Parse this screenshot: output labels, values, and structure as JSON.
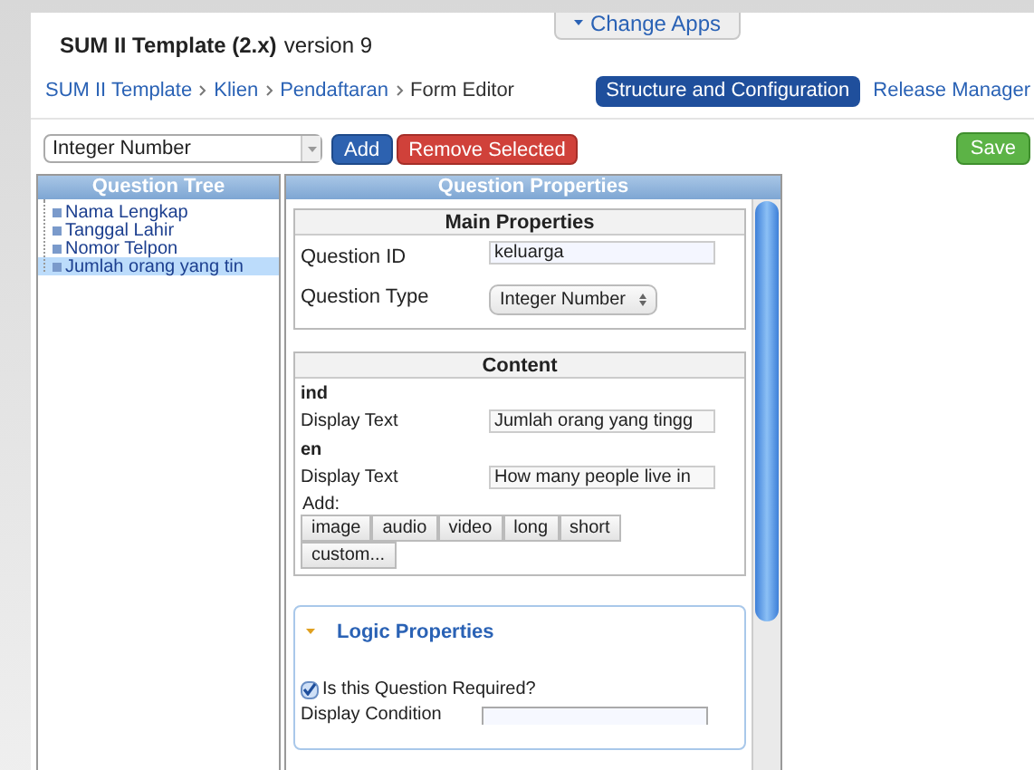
{
  "app_title": {
    "name": "SUM II Template (2.x)",
    "version": "version 9"
  },
  "change_apps": {
    "label": "Change Apps"
  },
  "breadcrumb": [
    "SUM II Template",
    "Klien",
    "Pendaftaran",
    "Form Editor"
  ],
  "nav_tabs": [
    {
      "label": "Structure and Configuration",
      "selected": true
    },
    {
      "label": "Release Manager",
      "selected": false
    }
  ],
  "toolbar": {
    "type_select": "Integer Number",
    "buttons": [
      {
        "label": "Add",
        "kind": "primary"
      },
      {
        "label": "Remove Selected",
        "kind": "danger"
      }
    ],
    "save": "Save"
  },
  "question_tree": {
    "title": "Question Tree",
    "items": [
      {
        "label": "Nama Lengkap",
        "selected": false
      },
      {
        "label": "Tanggal Lahir",
        "selected": false
      },
      {
        "label": "Nomor Telpon",
        "selected": false
      },
      {
        "label": "Jumlah orang yang tin",
        "selected": true
      }
    ]
  },
  "question_properties": {
    "title": "Question Properties",
    "main": {
      "title": "Main Properties",
      "fields": [
        {
          "label": "Question ID",
          "kind": "text",
          "value": "keluarga"
        },
        {
          "label": "Question Type",
          "kind": "select",
          "value": "Integer Number"
        }
      ]
    },
    "content": {
      "title": "Content",
      "languages": [
        {
          "code": "ind",
          "label": "Display Text",
          "value": "Jumlah orang yang tingg"
        },
        {
          "code": "en",
          "label": "Display Text",
          "value": "How many people live in"
        }
      ],
      "add_label": "Add:",
      "add_buttons": [
        "image",
        "audio",
        "video",
        "long",
        "short",
        "custom..."
      ]
    },
    "logic": {
      "title": "Logic Properties",
      "expanded": true,
      "required": {
        "label": "Is this Question Required?",
        "checked": true
      },
      "display_condition": {
        "label": "Display Condition"
      }
    }
  }
}
